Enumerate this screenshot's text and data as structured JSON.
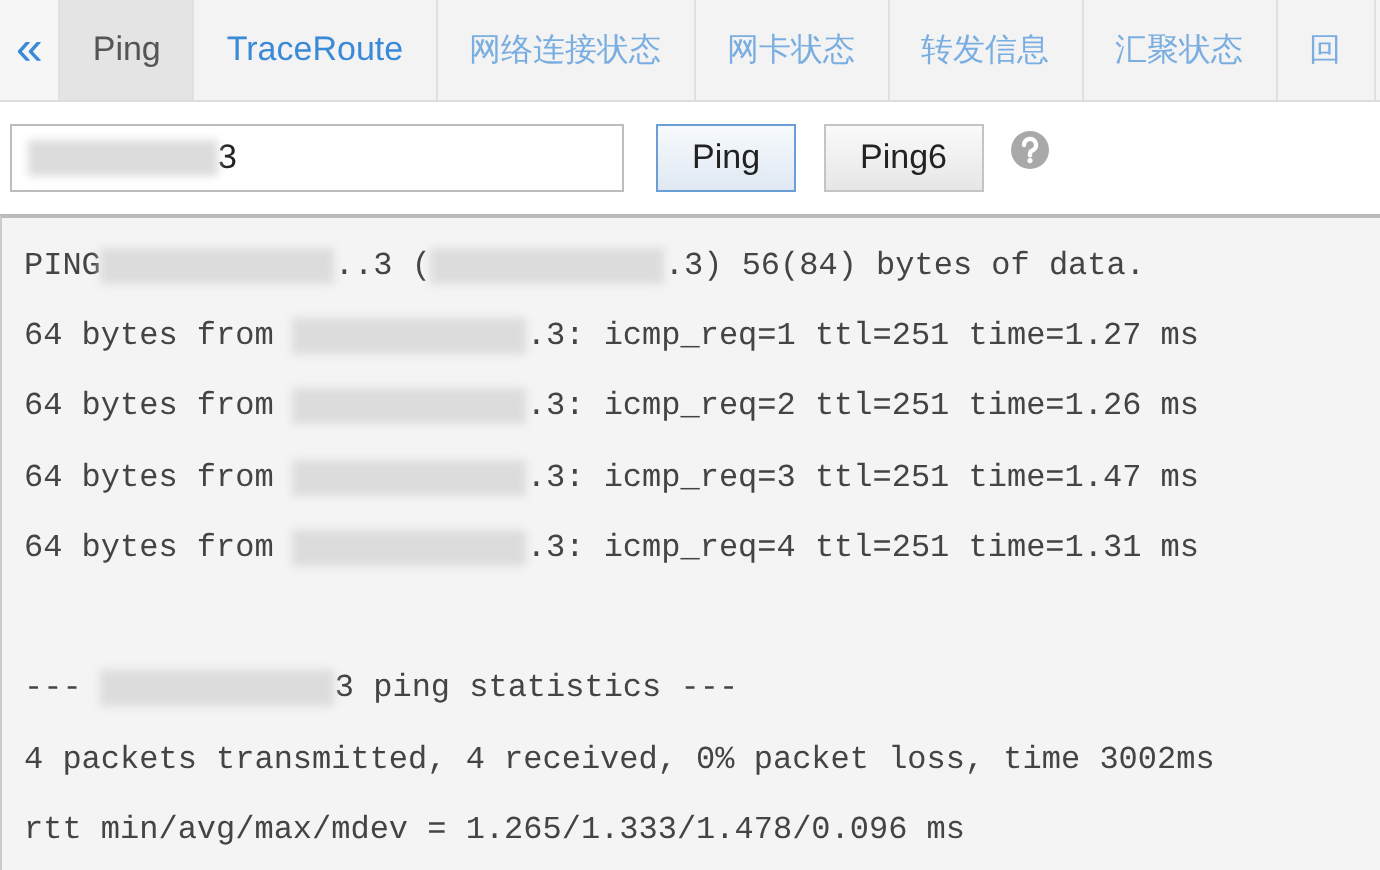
{
  "tabs": [
    {
      "label": "Ping",
      "selected": true,
      "kind": "link"
    },
    {
      "label": "TraceRoute",
      "selected": false,
      "kind": "link"
    },
    {
      "label": "网络连接状态",
      "selected": false,
      "kind": "plain"
    },
    {
      "label": "网卡状态",
      "selected": false,
      "kind": "plain"
    },
    {
      "label": "转发信息",
      "selected": false,
      "kind": "plain"
    },
    {
      "label": "汇聚状态",
      "selected": false,
      "kind": "plain"
    },
    {
      "label": "回",
      "selected": false,
      "kind": "plain"
    }
  ],
  "collapse": {
    "label": "«"
  },
  "address_field": {
    "segments": [
      {
        "kind": "redacted"
      },
      {
        "kind": "text",
        "text": "3"
      }
    ]
  },
  "buttons": [
    {
      "label": "Ping",
      "focused": true
    },
    {
      "label": "Ping6",
      "focused": false
    }
  ],
  "output": [
    {
      "kind": "text",
      "segments": [
        {
          "kind": "text",
          "text": "PING"
        },
        {
          "kind": "redacted"
        },
        {
          "kind": "text",
          "text": "..3 ("
        },
        {
          "kind": "redacted"
        },
        {
          "kind": "text",
          "text": ".3) 56(84) bytes of data."
        }
      ]
    },
    {
      "kind": "text",
      "segments": [
        {
          "kind": "text",
          "text": "64 bytes from "
        },
        {
          "kind": "redacted"
        },
        {
          "kind": "text",
          "text": ".3: icmp_req=1 ttl=251 time=1.27 ms"
        }
      ]
    },
    {
      "kind": "text",
      "segments": [
        {
          "kind": "text",
          "text": "64 bytes from "
        },
        {
          "kind": "redacted"
        },
        {
          "kind": "text",
          "text": ".3: icmp_req=2 ttl=251 time=1.26 ms"
        }
      ]
    },
    {
      "kind": "text",
      "segments": [
        {
          "kind": "text",
          "text": "64 bytes from "
        },
        {
          "kind": "redacted"
        },
        {
          "kind": "text",
          "text": ".3: icmp_req=3 ttl=251 time=1.47 ms"
        }
      ]
    },
    {
      "kind": "text",
      "segments": [
        {
          "kind": "text",
          "text": "64 bytes from "
        },
        {
          "kind": "redacted"
        },
        {
          "kind": "text",
          "text": ".3: icmp_req=4 ttl=251 time=1.31 ms"
        }
      ]
    },
    {
      "kind": "blank"
    },
    {
      "kind": "text",
      "segments": [
        {
          "kind": "text",
          "text": "--- "
        },
        {
          "kind": "redacted"
        },
        {
          "kind": "text",
          "text": "3 ping statistics ---"
        }
      ]
    },
    {
      "kind": "text",
      "segments": [
        {
          "kind": "text",
          "text": "4 packets transmitted, 4 received, 0% packet loss, time 3002ms"
        }
      ]
    },
    {
      "kind": "text",
      "segments": [
        {
          "kind": "text",
          "text": "rtt min/avg/max/mdev = 1.265/1.333/1.478/0.096 ms"
        }
      ]
    }
  ]
}
